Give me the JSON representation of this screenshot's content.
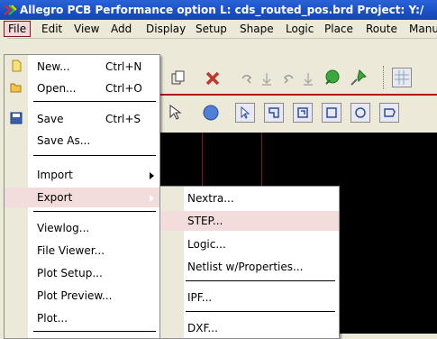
{
  "window": {
    "title": "Allegro PCB Performance option L: cds_routed_pos.brd  Project: Y:/"
  },
  "menubar": [
    {
      "label": "File",
      "key": "F"
    },
    {
      "label": "Edit",
      "key": "E"
    },
    {
      "label": "View",
      "key": "V"
    },
    {
      "label": "Add",
      "key": "A"
    },
    {
      "label": "Display",
      "key": "D"
    },
    {
      "label": "Setup",
      "key": "u"
    },
    {
      "label": "Shape",
      "key": "S"
    },
    {
      "label": "Logic",
      "key": "L"
    },
    {
      "label": "Place",
      "key": "P"
    },
    {
      "label": "Route",
      "key": "R"
    },
    {
      "label": "Manu",
      "key": "M"
    }
  ],
  "file_menu": {
    "items": [
      {
        "label": "New...",
        "shortcut": "Ctrl+N"
      },
      {
        "label": "Open...",
        "shortcut": "Ctrl+O"
      },
      {
        "label": "Save",
        "shortcut": "Ctrl+S"
      },
      {
        "label": "Save As..."
      },
      {
        "label": "Import"
      },
      {
        "label": "Export"
      },
      {
        "label": "Viewlog..."
      },
      {
        "label": "File Viewer..."
      },
      {
        "label": "Plot Setup..."
      },
      {
        "label": "Plot Preview..."
      },
      {
        "label": "Plot..."
      }
    ]
  },
  "export_menu": {
    "items": [
      {
        "label": "Nextra..."
      },
      {
        "label": "STEP..."
      },
      {
        "label": "Logic..."
      },
      {
        "label": "Netlist w/Properties..."
      },
      {
        "label": "IPF..."
      },
      {
        "label": "DXF..."
      }
    ]
  },
  "icons": {
    "copy": "copy-icon",
    "delete": "delete-x-icon",
    "undo": "undo-icon",
    "redo": "redo-icon",
    "ratsnest": "ratsnest-icon",
    "pin": "pin-icon"
  },
  "colors": {
    "titlebar": "#1a4fc4",
    "menu_highlight": "#f3dcdc",
    "canvas": "#000000",
    "accent_red": "#b3121c"
  }
}
